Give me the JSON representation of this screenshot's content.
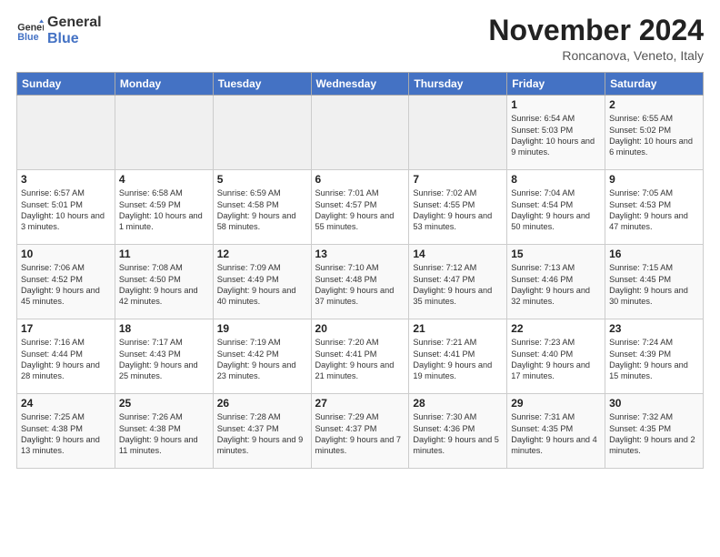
{
  "logo": {
    "general": "General",
    "blue": "Blue"
  },
  "title": "November 2024",
  "location": "Roncanova, Veneto, Italy",
  "days_of_week": [
    "Sunday",
    "Monday",
    "Tuesday",
    "Wednesday",
    "Thursday",
    "Friday",
    "Saturday"
  ],
  "weeks": [
    [
      {
        "day": "",
        "info": ""
      },
      {
        "day": "",
        "info": ""
      },
      {
        "day": "",
        "info": ""
      },
      {
        "day": "",
        "info": ""
      },
      {
        "day": "",
        "info": ""
      },
      {
        "day": "1",
        "info": "Sunrise: 6:54 AM\nSunset: 5:03 PM\nDaylight: 10 hours and 9 minutes."
      },
      {
        "day": "2",
        "info": "Sunrise: 6:55 AM\nSunset: 5:02 PM\nDaylight: 10 hours and 6 minutes."
      }
    ],
    [
      {
        "day": "3",
        "info": "Sunrise: 6:57 AM\nSunset: 5:01 PM\nDaylight: 10 hours and 3 minutes."
      },
      {
        "day": "4",
        "info": "Sunrise: 6:58 AM\nSunset: 4:59 PM\nDaylight: 10 hours and 1 minute."
      },
      {
        "day": "5",
        "info": "Sunrise: 6:59 AM\nSunset: 4:58 PM\nDaylight: 9 hours and 58 minutes."
      },
      {
        "day": "6",
        "info": "Sunrise: 7:01 AM\nSunset: 4:57 PM\nDaylight: 9 hours and 55 minutes."
      },
      {
        "day": "7",
        "info": "Sunrise: 7:02 AM\nSunset: 4:55 PM\nDaylight: 9 hours and 53 minutes."
      },
      {
        "day": "8",
        "info": "Sunrise: 7:04 AM\nSunset: 4:54 PM\nDaylight: 9 hours and 50 minutes."
      },
      {
        "day": "9",
        "info": "Sunrise: 7:05 AM\nSunset: 4:53 PM\nDaylight: 9 hours and 47 minutes."
      }
    ],
    [
      {
        "day": "10",
        "info": "Sunrise: 7:06 AM\nSunset: 4:52 PM\nDaylight: 9 hours and 45 minutes."
      },
      {
        "day": "11",
        "info": "Sunrise: 7:08 AM\nSunset: 4:50 PM\nDaylight: 9 hours and 42 minutes."
      },
      {
        "day": "12",
        "info": "Sunrise: 7:09 AM\nSunset: 4:49 PM\nDaylight: 9 hours and 40 minutes."
      },
      {
        "day": "13",
        "info": "Sunrise: 7:10 AM\nSunset: 4:48 PM\nDaylight: 9 hours and 37 minutes."
      },
      {
        "day": "14",
        "info": "Sunrise: 7:12 AM\nSunset: 4:47 PM\nDaylight: 9 hours and 35 minutes."
      },
      {
        "day": "15",
        "info": "Sunrise: 7:13 AM\nSunset: 4:46 PM\nDaylight: 9 hours and 32 minutes."
      },
      {
        "day": "16",
        "info": "Sunrise: 7:15 AM\nSunset: 4:45 PM\nDaylight: 9 hours and 30 minutes."
      }
    ],
    [
      {
        "day": "17",
        "info": "Sunrise: 7:16 AM\nSunset: 4:44 PM\nDaylight: 9 hours and 28 minutes."
      },
      {
        "day": "18",
        "info": "Sunrise: 7:17 AM\nSunset: 4:43 PM\nDaylight: 9 hours and 25 minutes."
      },
      {
        "day": "19",
        "info": "Sunrise: 7:19 AM\nSunset: 4:42 PM\nDaylight: 9 hours and 23 minutes."
      },
      {
        "day": "20",
        "info": "Sunrise: 7:20 AM\nSunset: 4:41 PM\nDaylight: 9 hours and 21 minutes."
      },
      {
        "day": "21",
        "info": "Sunrise: 7:21 AM\nSunset: 4:41 PM\nDaylight: 9 hours and 19 minutes."
      },
      {
        "day": "22",
        "info": "Sunrise: 7:23 AM\nSunset: 4:40 PM\nDaylight: 9 hours and 17 minutes."
      },
      {
        "day": "23",
        "info": "Sunrise: 7:24 AM\nSunset: 4:39 PM\nDaylight: 9 hours and 15 minutes."
      }
    ],
    [
      {
        "day": "24",
        "info": "Sunrise: 7:25 AM\nSunset: 4:38 PM\nDaylight: 9 hours and 13 minutes."
      },
      {
        "day": "25",
        "info": "Sunrise: 7:26 AM\nSunset: 4:38 PM\nDaylight: 9 hours and 11 minutes."
      },
      {
        "day": "26",
        "info": "Sunrise: 7:28 AM\nSunset: 4:37 PM\nDaylight: 9 hours and 9 minutes."
      },
      {
        "day": "27",
        "info": "Sunrise: 7:29 AM\nSunset: 4:37 PM\nDaylight: 9 hours and 7 minutes."
      },
      {
        "day": "28",
        "info": "Sunrise: 7:30 AM\nSunset: 4:36 PM\nDaylight: 9 hours and 5 minutes."
      },
      {
        "day": "29",
        "info": "Sunrise: 7:31 AM\nSunset: 4:35 PM\nDaylight: 9 hours and 4 minutes."
      },
      {
        "day": "30",
        "info": "Sunrise: 7:32 AM\nSunset: 4:35 PM\nDaylight: 9 hours and 2 minutes."
      }
    ]
  ]
}
